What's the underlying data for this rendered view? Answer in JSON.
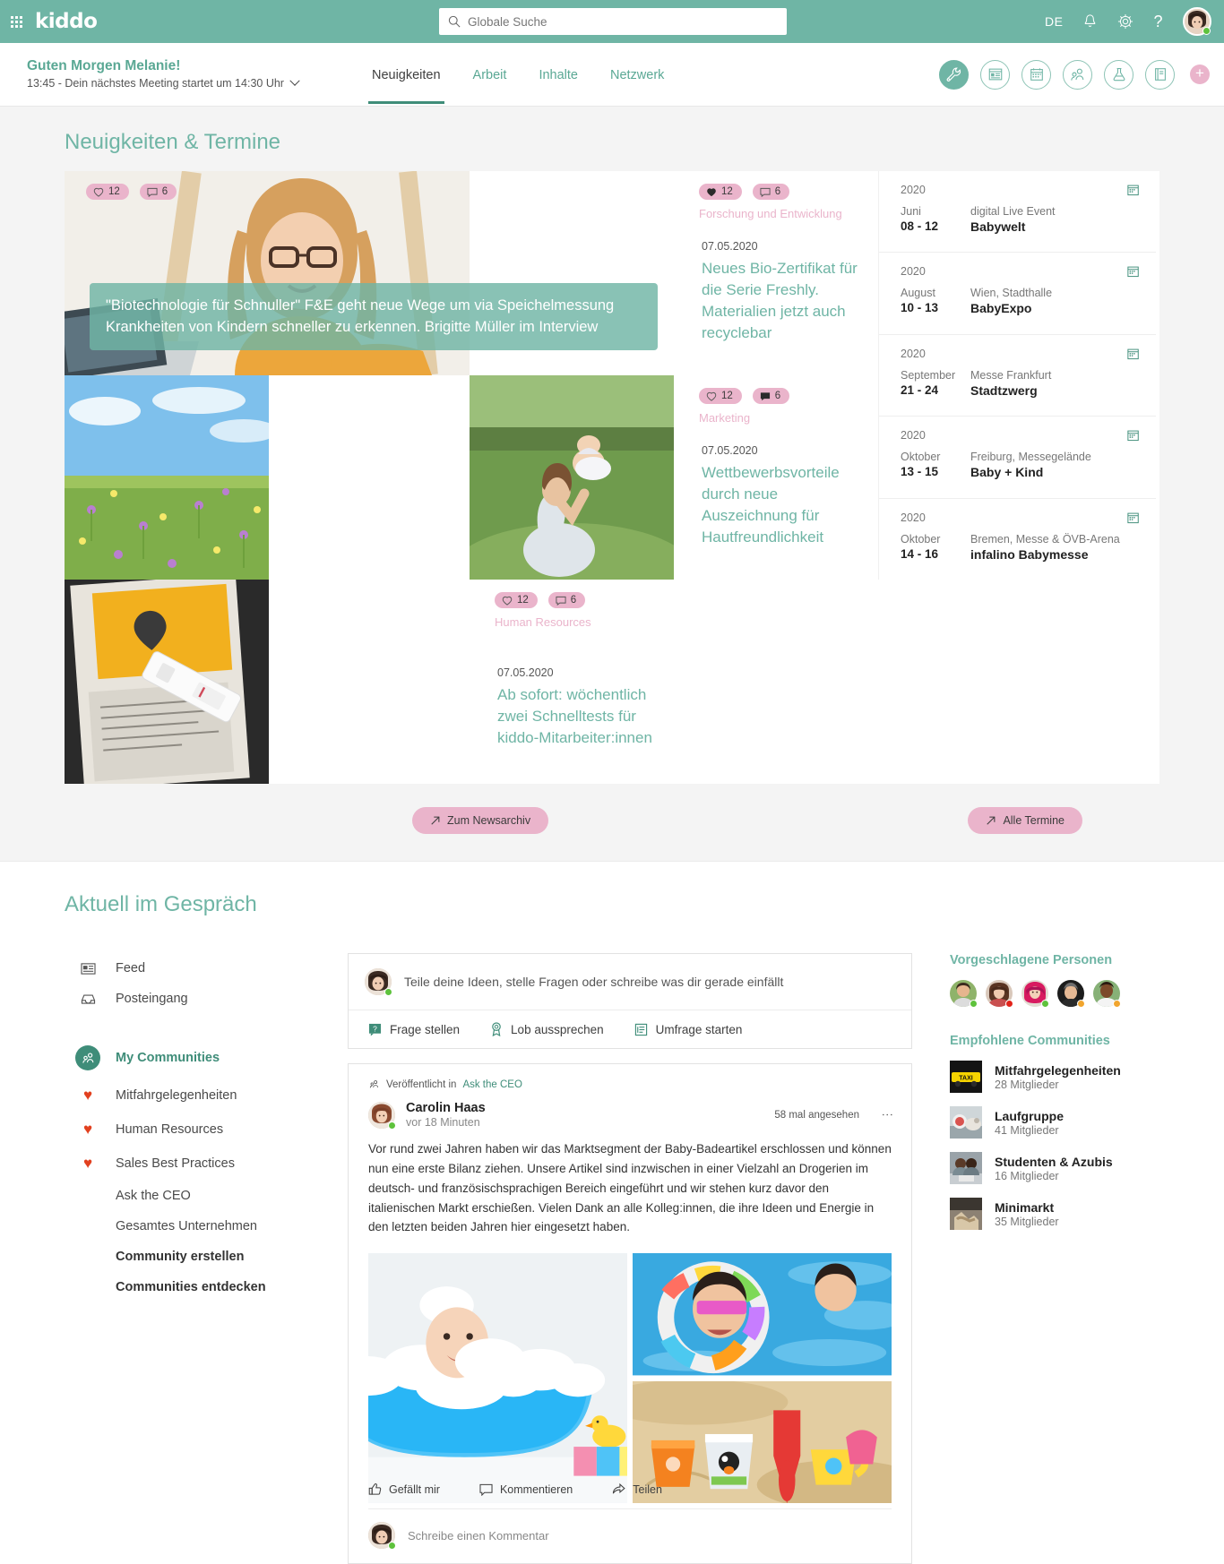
{
  "topbar": {
    "brand": "kiddo",
    "search_placeholder": "Globale Suche",
    "lang": "DE",
    "help": "?"
  },
  "subbar": {
    "greeting": "Guten Morgen Melanie!",
    "meeting": "13:45 - Dein nächstes Meeting startet um 14:30 Uhr",
    "nav": [
      {
        "label": "Neuigkeiten",
        "active": true
      },
      {
        "label": "Arbeit",
        "active": false
      },
      {
        "label": "Inhalte",
        "active": false
      },
      {
        "label": "Netzwerk",
        "active": false
      }
    ],
    "tools": [
      "wrench-icon",
      "dashboard-icon",
      "calendar-icon",
      "people-icon",
      "flask-icon",
      "book-icon"
    ],
    "plus": "+"
  },
  "news": {
    "title": "Neuigkeiten & Termine",
    "hero": {
      "likes": "12",
      "comments": "6",
      "caption": "\"Biotechnologie für Schnuller\" F&E geht neue Wege um via Speichelmessung Krankheiten von Kindern schneller zu erkennen. Brigitte Müller im Interview"
    },
    "cards": [
      {
        "likes": "12",
        "comments": "6",
        "category": "Forschung und Entwicklung",
        "date": "07.05.2020",
        "title": "Neues Bio-Zertifikat für die Serie Freshly. Materialien jetzt auch recyclebar"
      },
      {
        "likes": "12",
        "comments": "6",
        "category": "Marketing",
        "date": "07.05.2020",
        "title": "Wettbewerbsvorteile durch neue Auszeichnung für Hautfreundlichkeit"
      },
      {
        "likes": "12",
        "comments": "6",
        "category": "Human Resources",
        "date": "07.05.2020",
        "title": "Ab sofort: wöchentlich zwei Schnelltests für kiddo-Mitarbeiter:innen"
      }
    ],
    "events": [
      {
        "year": "2020",
        "month": "Juni",
        "days": "08 - 12",
        "location": "digital Live Event",
        "name": "Babywelt"
      },
      {
        "year": "2020",
        "month": "August",
        "days": "10 - 13",
        "location": "Wien, Stadthalle",
        "name": "BabyExpo"
      },
      {
        "year": "2020",
        "month": "September",
        "days": "21 - 24",
        "location": "Messe Frankfurt",
        "name": "Stadtzwerg"
      },
      {
        "year": "2020",
        "month": "Oktober",
        "days": "13 - 15",
        "location": "Freiburg, Messegelände",
        "name": "Baby + Kind"
      },
      {
        "year": "2020",
        "month": "Oktober",
        "days": "14 - 16",
        "location": "Bremen, Messe & ÖVB-Arena",
        "name": "infalino Babymesse"
      }
    ],
    "archive_button": "Zum Newsarchiv",
    "events_button": "Alle Termine"
  },
  "talk": {
    "title": "Aktuell im Gespräch",
    "sidebar": [
      {
        "label": "Feed",
        "icon": "feed-icon",
        "type": "icon"
      },
      {
        "label": "Posteingang",
        "icon": "inbox-icon",
        "type": "icon"
      },
      {
        "label": "My Communities",
        "icon": "communities-icon",
        "type": "active"
      },
      {
        "label": "Mitfahrgelegenheiten",
        "icon": "heart-icon",
        "type": "heart"
      },
      {
        "label": "Human Resources",
        "icon": "heart-icon",
        "type": "heart"
      },
      {
        "label": "Sales Best Practices",
        "icon": "heart-icon",
        "type": "heart"
      },
      {
        "label": "Ask the CEO",
        "icon": "",
        "type": "plain"
      },
      {
        "label": "Gesamtes Unternehmen",
        "icon": "",
        "type": "plain"
      },
      {
        "label": "Community erstellen",
        "icon": "",
        "type": "bold"
      },
      {
        "label": "Communities entdecken",
        "icon": "",
        "type": "bold"
      }
    ],
    "composer": {
      "placeholder": "Teile deine Ideen, stelle Fragen oder schreibe was dir gerade einfällt",
      "actions": [
        {
          "label": "Frage stellen",
          "icon": "question-icon"
        },
        {
          "label": "Lob aussprechen",
          "icon": "award-icon"
        },
        {
          "label": "Umfrage starten",
          "icon": "poll-icon"
        }
      ]
    },
    "post": {
      "published_prefix": "Veröffentlicht in",
      "published_community": "Ask the CEO",
      "author": "Carolin Haas",
      "time": "vor 18 Minuten",
      "views": "58 mal angesehen",
      "body": "Vor rund zwei Jahren haben wir das Marktsegment der Baby-Badeartikel erschlossen und können nun eine erste Bilanz ziehen. Unsere Artikel sind inzwischen in einer Vielzahl an Drogerien im deutsch- und französischsprachigen Bereich eingeführt und wir stehen kurz davor den italienischen Markt erschießen. Vielen Dank an alle Kolleg:innen, die ihre Ideen und Energie in den letzten beiden Jahren hier eingesetzt haben.",
      "actions": [
        {
          "label": "Gefällt mir",
          "icon": "thumbs-up-icon"
        },
        {
          "label": "Kommentieren",
          "icon": "comment-icon"
        },
        {
          "label": "Teilen",
          "icon": "share-icon"
        }
      ],
      "comment_placeholder": "Schreibe einen Kommentar"
    },
    "rail": {
      "people_title": "Vorgeschlagene Personen",
      "people": [
        {
          "status": "green"
        },
        {
          "status": "red"
        },
        {
          "status": "green"
        },
        {
          "status": "orange"
        },
        {
          "status": "orange"
        }
      ],
      "communities_title": "Empfohlene Communities",
      "communities": [
        {
          "name": "Mitfahrgelegenheiten",
          "members": "28 Mitglieder"
        },
        {
          "name": "Laufgruppe",
          "members": "41 Mitglieder"
        },
        {
          "name": "Studenten & Azubis",
          "members": "16 Mitglieder"
        },
        {
          "name": "Minimarkt",
          "members": "35 Mitglieder"
        }
      ]
    }
  },
  "colors": {
    "brand_teal": "#6fb5a5",
    "dark_teal": "#3f8d79",
    "pink": "#eab4cb",
    "heart_red": "#e2401f"
  }
}
